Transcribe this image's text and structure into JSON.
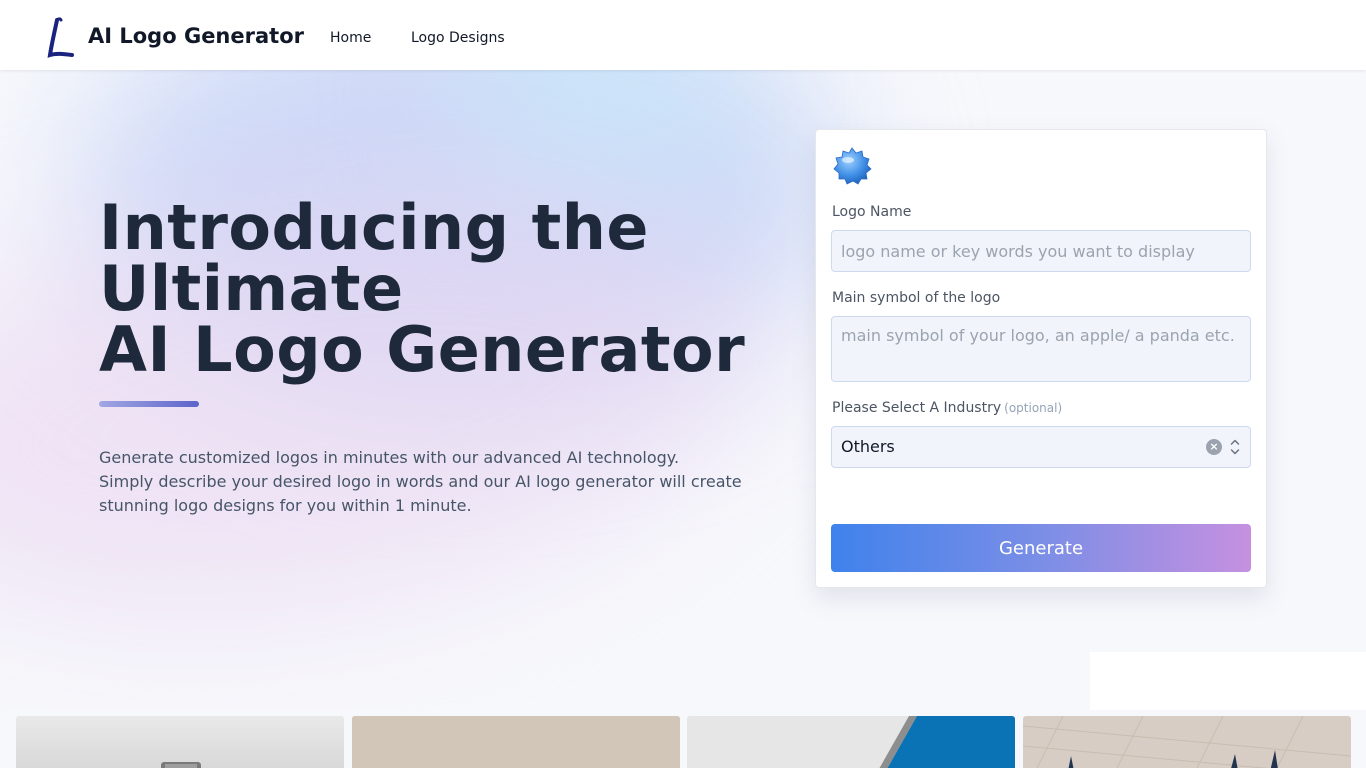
{
  "nav": {
    "brand_name": "AI Logo Generator",
    "logo_icon": "letter-l-brush-logo",
    "links": [
      {
        "label": "Home"
      },
      {
        "label": "Logo Designs"
      }
    ]
  },
  "hero": {
    "title_line1": "Introducing the",
    "title_line2": "Ultimate",
    "title_line3": "AI Logo Generator",
    "description_line1": "Generate customized logos in minutes with our advanced AI technology.",
    "description_line2": "Simply describe your desired logo in words and our AI logo generator will create",
    "description_line3": "stunning logo designs for you within 1 minute."
  },
  "form": {
    "icon": "blue-gear-badge-icon",
    "logo_name_label": "Logo Name",
    "logo_name_value": "",
    "logo_name_placeholder": "logo name or key words you want to display",
    "symbol_label": "Main symbol of the logo",
    "symbol_value": "",
    "symbol_placeholder": "main symbol of your logo, an apple/ a panda etc.",
    "industry_label": "Please Select A Industry",
    "industry_optional": "(optional)",
    "industry_selected": "Others",
    "generate_label": "Generate"
  },
  "colors": {
    "title": "#1e293b",
    "button_gradient_start": "#3f82ec",
    "button_gradient_end": "#c690e0",
    "accent_bar": "#5c63c9"
  },
  "gallery": {
    "thumbnails": [
      "logo-mockup-1",
      "logo-mockup-2",
      "logo-mockup-3",
      "logo-mockup-4"
    ]
  }
}
